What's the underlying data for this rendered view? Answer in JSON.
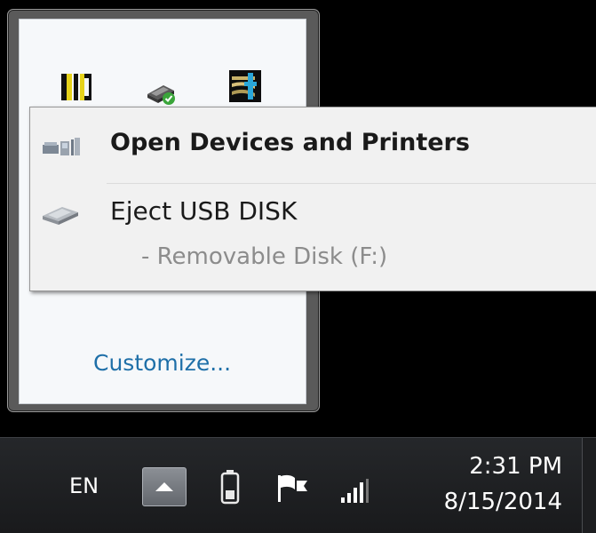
{
  "tray_flyout": {
    "icons": [
      "dic-icon",
      "usb-drive-check-icon",
      "tools-app-icon"
    ],
    "customize_label": "Customize..."
  },
  "context_menu": {
    "open_devices_label": "Open Devices and Printers",
    "eject_label": "Eject USB DISK",
    "eject_sub_label": "-  Removable Disk (F:)"
  },
  "taskbar": {
    "language": "EN",
    "time": "2:31 PM",
    "date": "8/15/2014"
  },
  "colors": {
    "link": "#1e6fa8",
    "menu_bg": "#f1f1f1",
    "taskbar_bg": "#1f2023"
  }
}
